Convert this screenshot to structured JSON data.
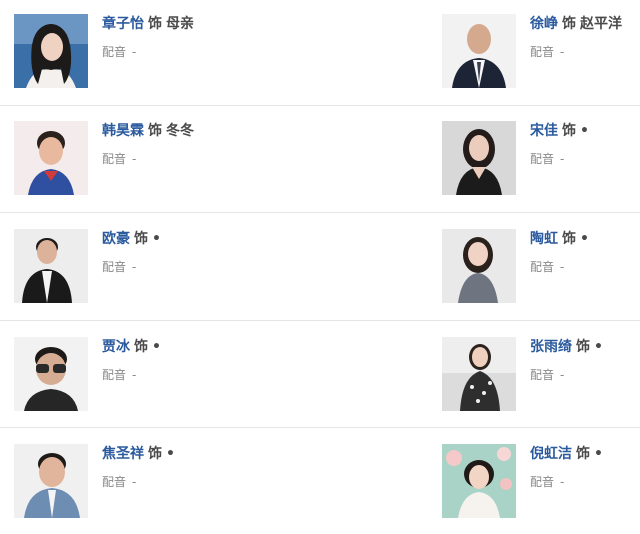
{
  "cast": [
    {
      "actor": "章子怡",
      "as": "饰",
      "role": "母亲",
      "voice_label": "配音",
      "voice_value": "-",
      "photo": "portrait-woman-long-dark-hair",
      "bg": "#3b6fa8"
    },
    {
      "actor": "徐峥",
      "as": "饰",
      "role": "赵平洋",
      "voice_label": "配音",
      "voice_value": "-",
      "photo": "portrait-man-bald-suit",
      "bg": "#f2f2f2"
    },
    {
      "actor": "韩昊霖",
      "as": "饰",
      "role": "冬冬",
      "voice_label": "配音",
      "voice_value": "-",
      "photo": "portrait-boy",
      "bg": "#f4ecec"
    },
    {
      "actor": "宋佳",
      "as": "饰",
      "role": "•",
      "voice_label": "配音",
      "voice_value": "-",
      "photo": "portrait-woman-dark-dress",
      "bg": "#d8d8d8"
    },
    {
      "actor": "欧豪",
      "as": "饰",
      "role": "•",
      "voice_label": "配音",
      "voice_value": "-",
      "photo": "portrait-man-dark-suit",
      "bg": "#ededed"
    },
    {
      "actor": "陶虹",
      "as": "饰",
      "role": "•",
      "voice_label": "配音",
      "voice_value": "-",
      "photo": "portrait-woman-grey-dress",
      "bg": "#e9e9e9"
    },
    {
      "actor": "贾冰",
      "as": "饰",
      "role": "•",
      "voice_label": "配音",
      "voice_value": "-",
      "photo": "portrait-man-glasses",
      "bg": "#f2f2f2"
    },
    {
      "actor": "张雨绮",
      "as": "饰",
      "role": "•",
      "voice_label": "配音",
      "voice_value": "-",
      "photo": "portrait-woman-patterned-dress",
      "bg": "#dcdcdc"
    },
    {
      "actor": "焦圣祥",
      "as": "饰",
      "role": "•",
      "voice_label": "配音",
      "voice_value": "-",
      "photo": "portrait-boy-denim-jacket",
      "bg": "#f0f0f0"
    },
    {
      "actor": "倪虹洁",
      "as": "饰",
      "role": "•",
      "voice_label": "配音",
      "voice_value": "-",
      "photo": "portrait-woman-short-hair-flowers",
      "bg": "#a9d3c6"
    }
  ],
  "colors": {
    "actor_link": "#2b5b9e",
    "text": "#4a4a4a",
    "muted": "#888888",
    "divider": "#e6e6e6"
  }
}
